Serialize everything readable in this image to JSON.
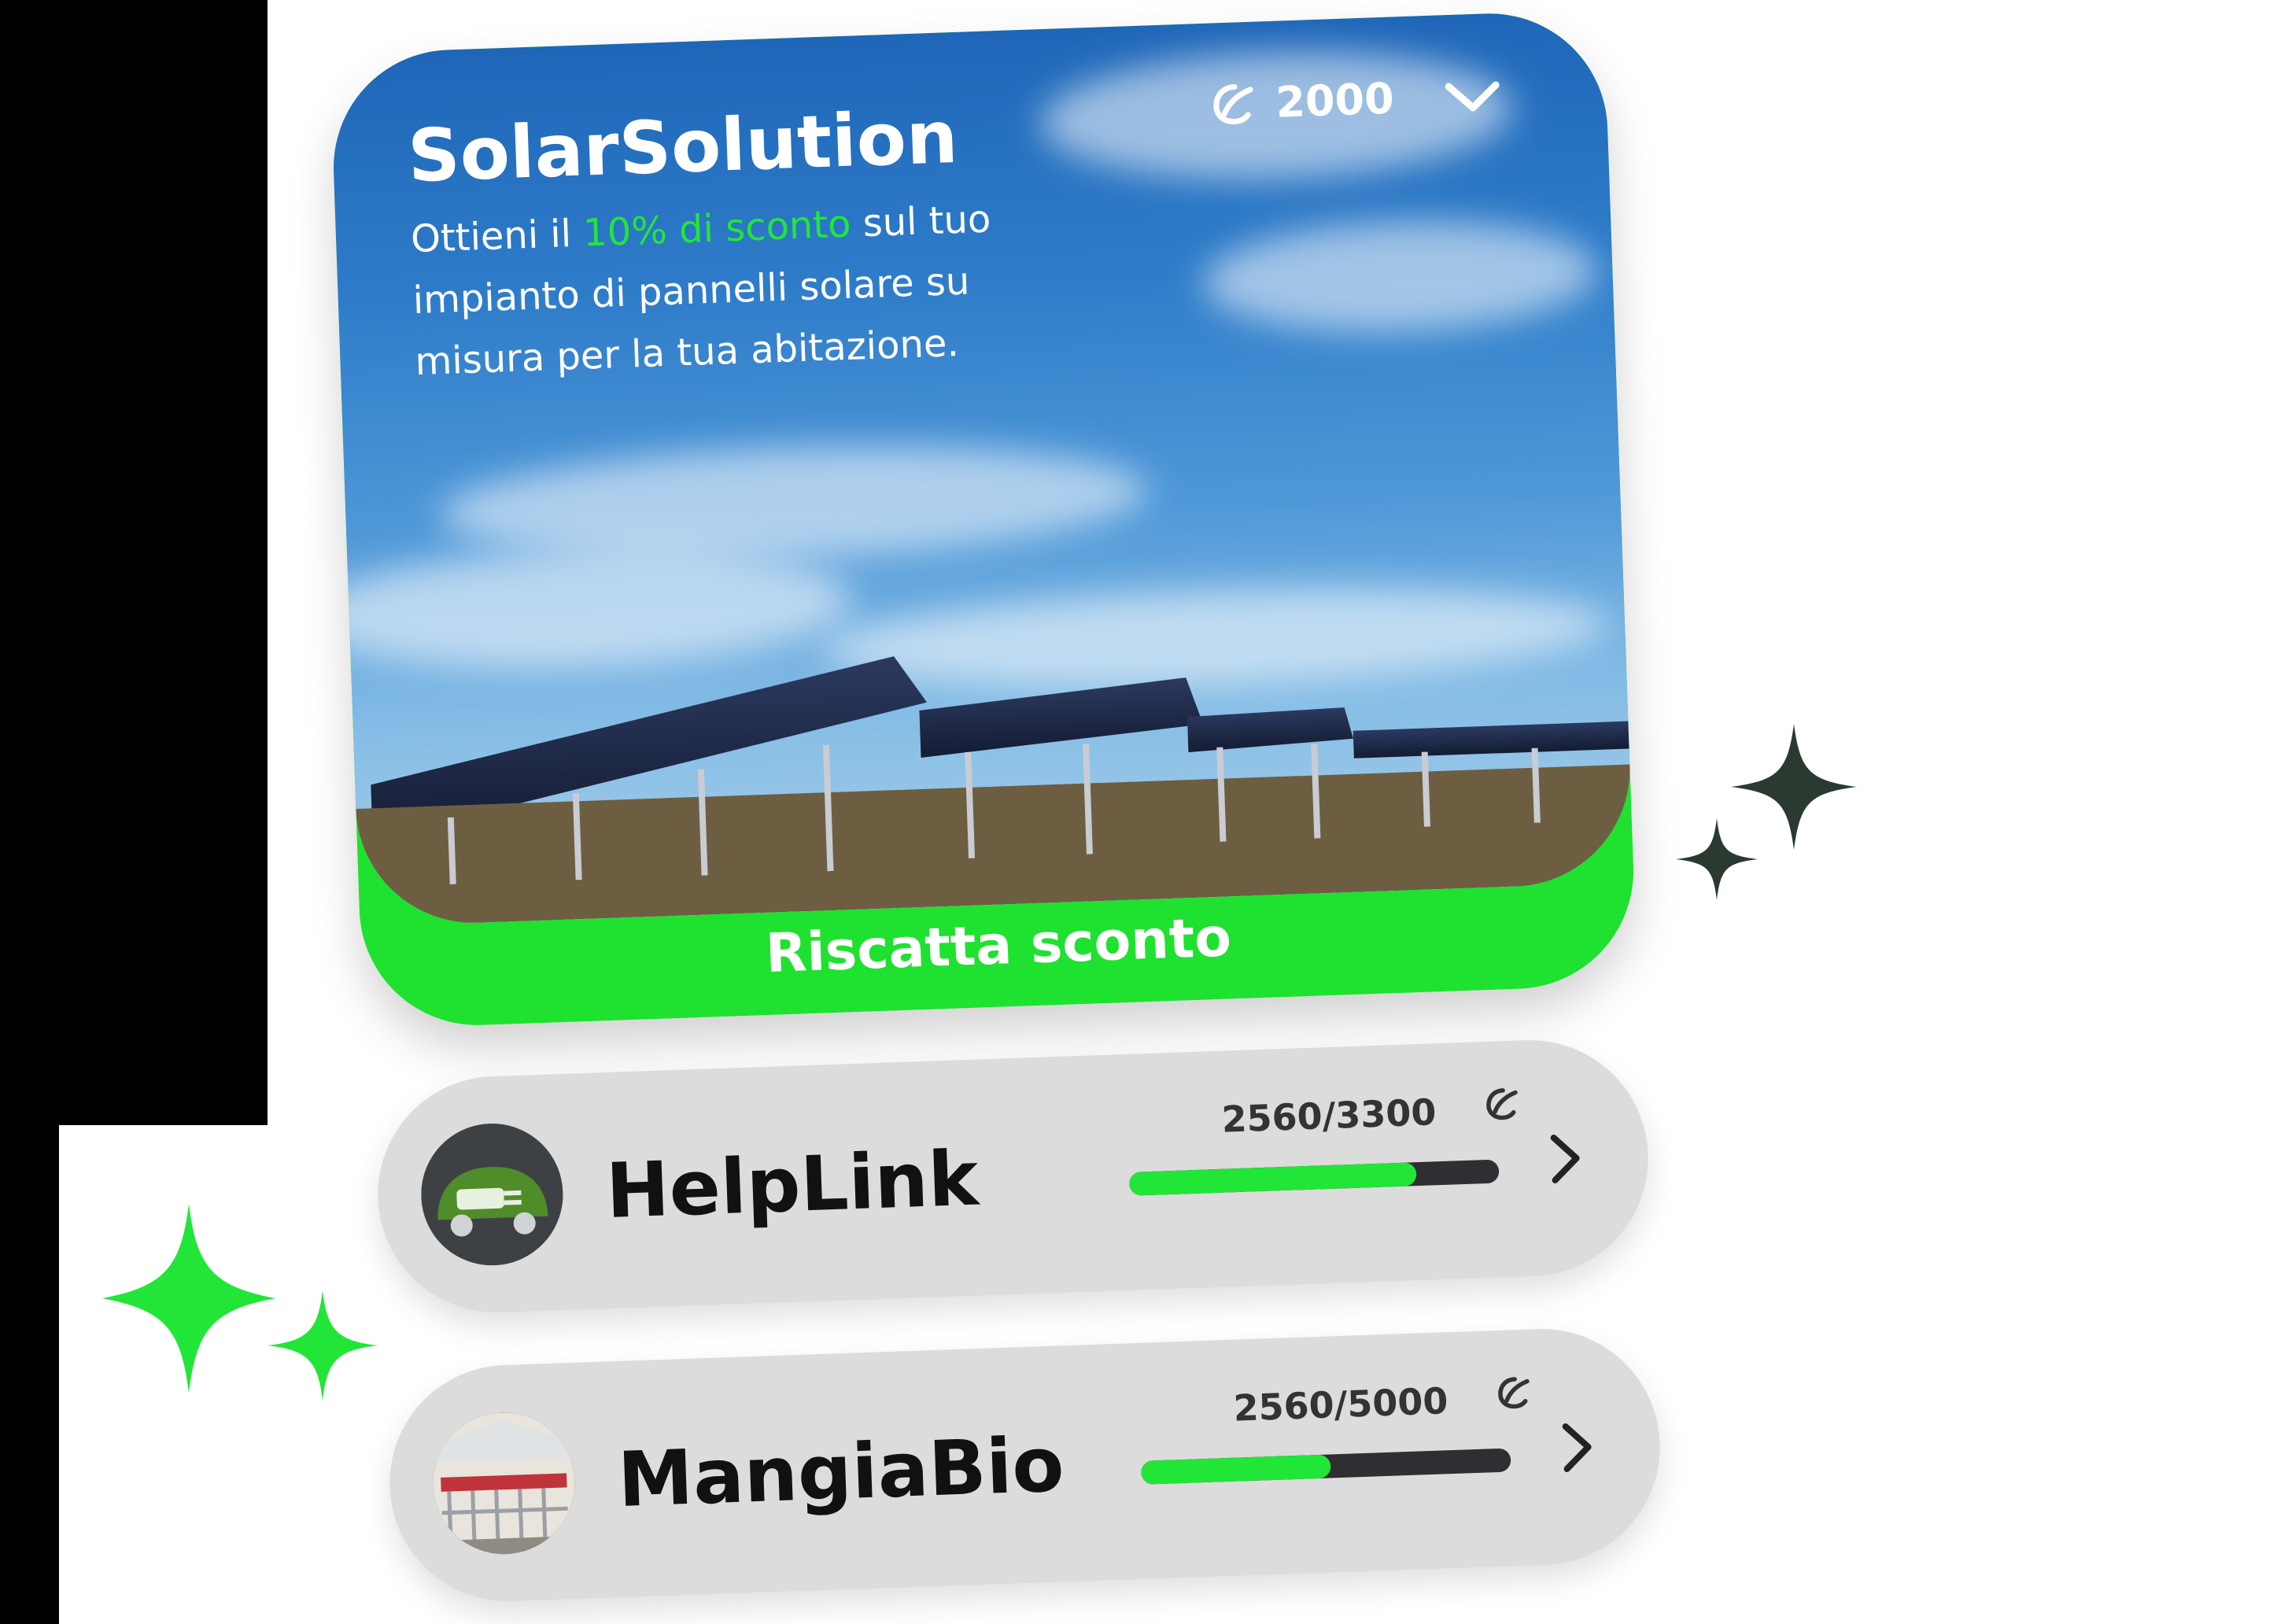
{
  "card": {
    "title": "SolarSolution",
    "desc_before": "Ottieni il ",
    "desc_highlight": "10% di sconto",
    "desc_after": " sul tuo impianto di pannelli solare su misura per la tua abitazione.",
    "points": "2000",
    "cta": "Riscatta sconto",
    "colors": {
      "accent": "#22e637",
      "sky": "#2e7cc9"
    },
    "icons": {
      "points": "leaf-coin-icon",
      "expand": "chevron-down-icon"
    }
  },
  "rewards": [
    {
      "name": "HelpLink",
      "count": "2560/3300",
      "progress": 0.7758,
      "avatar": "ev-plug-car-icon"
    },
    {
      "name": "MangiaBio",
      "count": "2560/5000",
      "progress": 0.512,
      "avatar": "shopping-carts-photo"
    }
  ]
}
